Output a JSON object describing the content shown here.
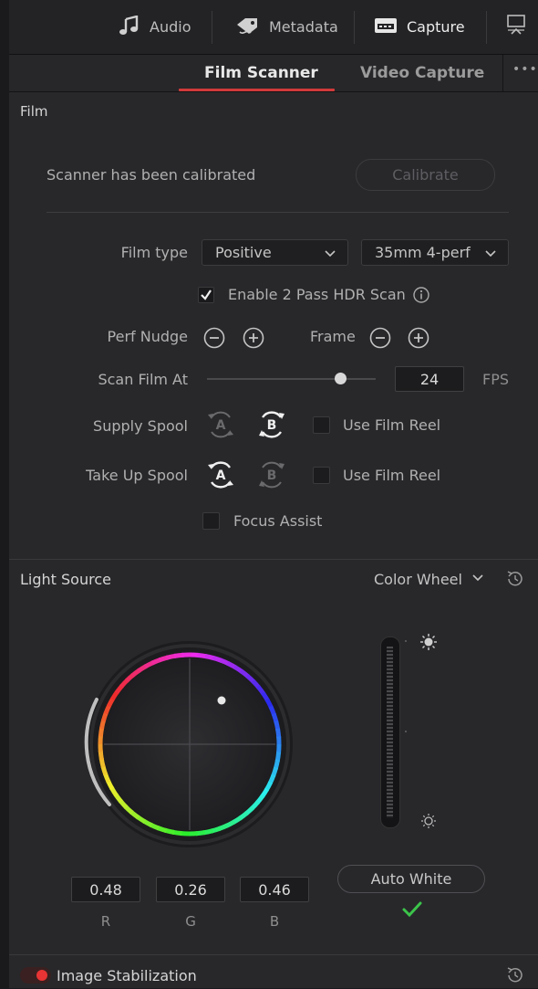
{
  "topbar": {
    "audio_label": "Audio",
    "metadata_label": "Metadata",
    "capture_label": "Capture",
    "icons": [
      "music-note-icon",
      "metadata-tag-icon",
      "capture-icon",
      "display-icon"
    ]
  },
  "tabs": [
    {
      "label": "Film Scanner",
      "active": true
    },
    {
      "label": "Video Capture",
      "active": false
    }
  ],
  "more_label": "•••",
  "film": {
    "title": "Film",
    "calibration_status": "Scanner has been calibrated",
    "calibrate_label": "Calibrate",
    "film_type_label": "Film type",
    "film_type_value": "Positive",
    "film_format_value": "35mm 4-perf",
    "hdr_label": "Enable 2 Pass HDR Scan",
    "hdr_checked": true,
    "perf_nudge_label": "Perf Nudge",
    "frame_label": "Frame",
    "scan_film_at_label": "Scan Film At",
    "scan_fps_value": "24",
    "fps_unit": "FPS",
    "scan_slider_fraction": 0.79,
    "supply_spool_label": "Supply Spool",
    "take_up_spool_label": "Take Up Spool",
    "use_film_reel_label": "Use Film Reel",
    "supply_selected": "B",
    "takeup_selected": "A",
    "focus_assist_label": "Focus Assist"
  },
  "light_source": {
    "title": "Light Source",
    "mode_value": "Color Wheel",
    "r_value": "0.48",
    "g_value": "0.26",
    "b_value": "0.46",
    "r_label": "R",
    "g_label": "G",
    "b_label": "B",
    "auto_white_label": "Auto White",
    "accent_green": "#3cc44a"
  },
  "stabilization": {
    "label": "Image Stabilization",
    "toggle_color": "#e83434"
  },
  "colors": {
    "tab_underline": "#d23a3a",
    "panel_bg": "#28282b"
  }
}
